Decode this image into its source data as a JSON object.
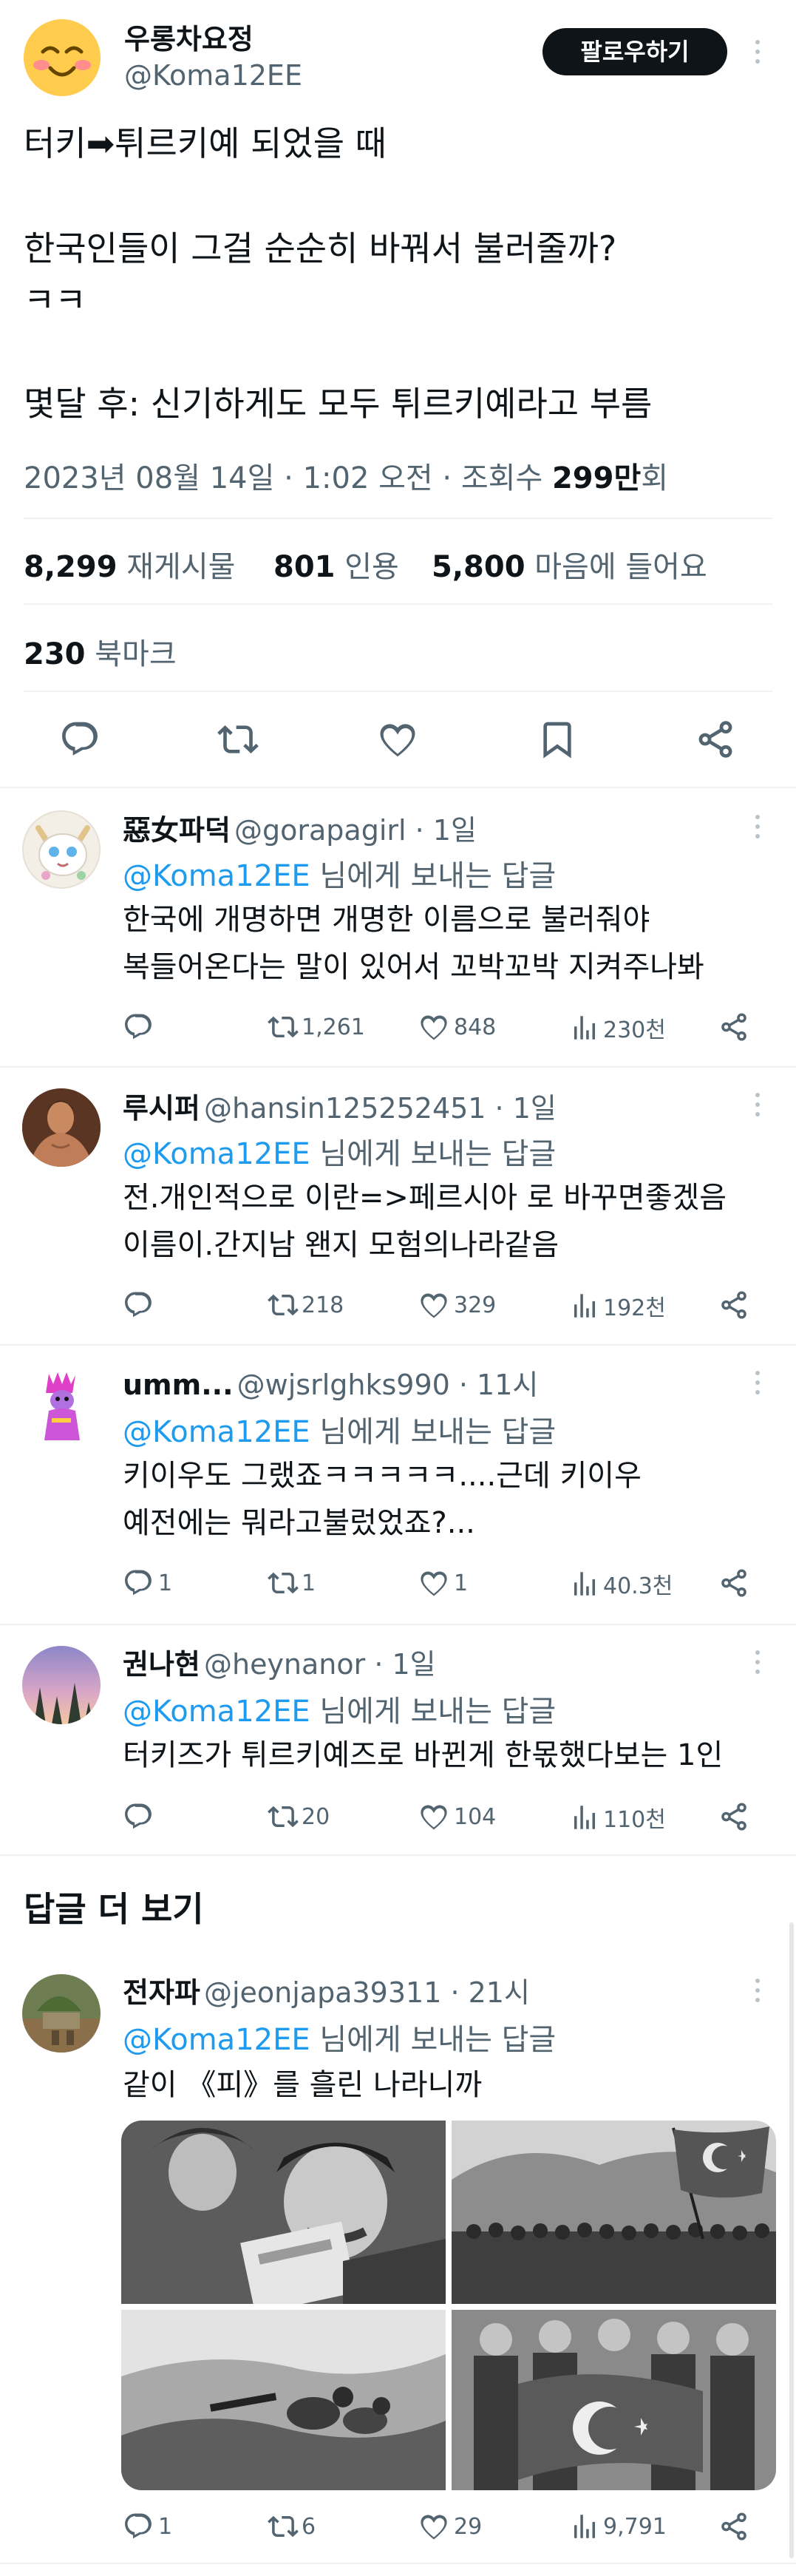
{
  "main_tweet": {
    "author_name": "우롱차요정",
    "author_handle": "@Koma12EE",
    "follow_label": "팔로우하기",
    "text_line1": "터키➡튀르키예 되었을 때",
    "text_line2": "한국인들이 그걸 순순히 바꿔서 불러줄까?",
    "text_line3": "ㅋㅋ",
    "text_line4": "몇달 후: 신기하게도 모두 튀르키예라고 부름",
    "timestamp": "2023년 08월 14일 · 1:02 오전 · 조회수 ",
    "views_value": "299만",
    "views_suffix": "회",
    "stats": {
      "retweets_value": "8,299",
      "retweets_label": "재게시물",
      "quotes_value": "801",
      "quotes_label": "인용",
      "likes_value": "5,800",
      "likes_label": "마음에 들어요",
      "bookmarks_value": "230",
      "bookmarks_label": "북마크"
    },
    "icons": [
      "reply-icon",
      "retweet-icon",
      "like-icon",
      "bookmark-icon",
      "share-icon"
    ]
  },
  "replies": [
    {
      "name": "惡女파덕",
      "handle": "@gorapagirl · 1일",
      "reply_to_handle": "@Koma12EE",
      "reply_to_suffix": " 님에게 보내는 답글",
      "line1": "한국에 개명하면 개명한 이름으로 불러줘야",
      "line2": "복들어온다는 말이 있어서 꼬박꼬박 지켜주나봐",
      "replies_count": "",
      "retweets": "1,261",
      "likes": "848",
      "views": "230천"
    },
    {
      "name": "루시퍼",
      "handle": "@hansin125252451 · 1일",
      "reply_to_handle": "@Koma12EE",
      "reply_to_suffix": " 님에게 보내는 답글",
      "line1": "전.개인적으로 이란=>페르시아 로 바꾸면좋겠음",
      "line2": "이름이.간지남 왠지 모험의나라같음",
      "replies_count": "",
      "retweets": "218",
      "likes": "329",
      "views": "192천"
    },
    {
      "name": "umm...",
      "handle": "@wjsrlghks990 · 11시",
      "reply_to_handle": "@Koma12EE",
      "reply_to_suffix": " 님에게 보내는 답글",
      "line1": "키이우도 그랬죠ㅋㅋㅋㅋㅋ....근데 키이우",
      "line2": "예전에는 뭐라고불렀었죠?...",
      "replies_count": "1",
      "retweets": "1",
      "likes": "1",
      "views": "40.3천"
    },
    {
      "name": "권나현",
      "handle": "@heynanor · 1일",
      "reply_to_handle": "@Koma12EE",
      "reply_to_suffix": " 님에게 보내는 답글",
      "line1": "터키즈가 튀르키예즈로 바뀐게 한몫했다보는 1인",
      "line2": "",
      "replies_count": "",
      "retweets": "20",
      "likes": "104",
      "views": "110천"
    }
  ],
  "more_replies_heading": "답글 더 보기",
  "more_reply": {
    "name": "전자파",
    "handle": "@jeonjapa39311 · 21시",
    "reply_to_handle": "@Koma12EE",
    "reply_to_suffix": " 님에게 보내는 답글",
    "line1": "같이 《피》를 흘린 나라니까",
    "replies_count": "1",
    "retweets": "6",
    "likes": "29",
    "views": "9,791",
    "photos": [
      "man-reading-comic-photo",
      "soldiers-with-flag-photo",
      "machine-gun-position-photo",
      "soldiers-holding-turkish-flag-photo"
    ]
  },
  "colors": {
    "link": "#1d9bf0",
    "muted": "#536471",
    "follow_button": "#0f1419",
    "divider": "#eff3f4"
  }
}
